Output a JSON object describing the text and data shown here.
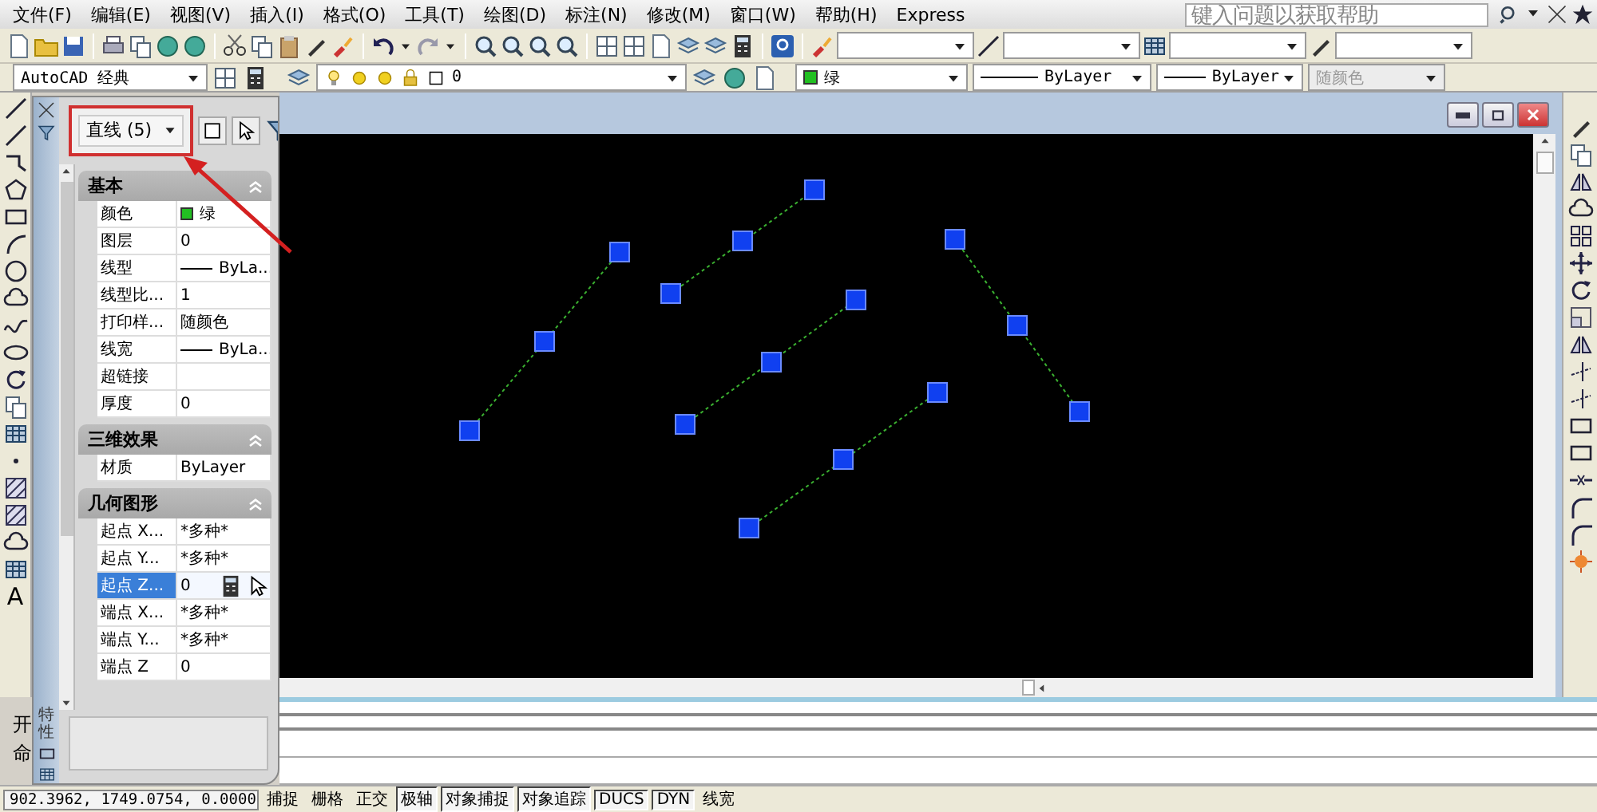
{
  "menu": [
    "文件(F)",
    "编辑(E)",
    "视图(V)",
    "插入(I)",
    "格式(O)",
    "工具(T)",
    "绘图(D)",
    "标注(N)",
    "修改(M)",
    "窗口(W)",
    "帮助(H)",
    "Express"
  ],
  "help_search": {
    "placeholder": "键入问题以获取帮助"
  },
  "workspace": {
    "value": "AutoCAD 经典"
  },
  "layer": {
    "value": "0"
  },
  "color": {
    "value": "绿",
    "color": "#22c022"
  },
  "linetype": {
    "value": "ByLayer"
  },
  "lineweight": {
    "value": "ByLayer"
  },
  "plot_style": {
    "value": "随颜色",
    "disabled": true
  },
  "properties": {
    "selection": "直线 (5)",
    "palette_title": "特性",
    "sections": [
      {
        "title": "基本",
        "expanded": true,
        "rows": [
          {
            "label": "颜色",
            "value": "绿",
            "kind": "swatch",
            "color": "#22c022",
            "selected": false
          },
          {
            "label": "图层",
            "value": "0",
            "kind": "text",
            "selected": false
          },
          {
            "label": "线型",
            "value": "ByLa...",
            "kind": "line",
            "selected": false
          },
          {
            "label": "线型比...",
            "value": "1",
            "kind": "text",
            "selected": false
          },
          {
            "label": "打印样...",
            "value": "随颜色",
            "kind": "text",
            "selected": false
          },
          {
            "label": "线宽",
            "value": "ByLa...",
            "kind": "line",
            "selected": false
          },
          {
            "label": "超链接",
            "kind": "text",
            "selected": false
          },
          {
            "label": "厚度",
            "value": "0",
            "kind": "text",
            "selected": false
          }
        ]
      },
      {
        "title": "三维效果",
        "expanded": true,
        "rows": [
          {
            "label": "材质",
            "value": "ByLayer",
            "kind": "text",
            "selected": false
          }
        ]
      },
      {
        "title": "几何图形",
        "expanded": true,
        "rows": [
          {
            "label": "起点 X...",
            "value": "*多种*",
            "kind": "text",
            "selected": false
          },
          {
            "label": "起点 Y...",
            "value": "*多种*",
            "kind": "text",
            "selected": false
          },
          {
            "label": "起点 Z...",
            "value": "0",
            "kind": "text",
            "selected": true
          },
          {
            "label": "端点 X...",
            "value": "*多种*",
            "kind": "text",
            "selected": false
          },
          {
            "label": "端点 Y...",
            "value": "*多种*",
            "kind": "text",
            "selected": false
          },
          {
            "label": "端点 Z",
            "value": "0",
            "kind": "text",
            "selected": false
          }
        ]
      }
    ]
  },
  "draw_toolbar": {
    "text_button": "A"
  },
  "command_lines": [
    "开",
    "命"
  ],
  "status": {
    "coordinates": "902.3962, 1749.0754, 0.0000",
    "toggles": [
      {
        "label": "捕捉",
        "on": false
      },
      {
        "label": "栅格",
        "on": false
      },
      {
        "label": "正交",
        "on": false
      },
      {
        "label": "极轴",
        "on": true
      },
      {
        "label": "对象捕捉",
        "on": true
      },
      {
        "label": "对象追踪",
        "on": true
      },
      {
        "label": "DUCS",
        "on": true
      },
      {
        "label": "DYN",
        "on": true
      },
      {
        "label": "线宽",
        "on": false
      }
    ]
  }
}
